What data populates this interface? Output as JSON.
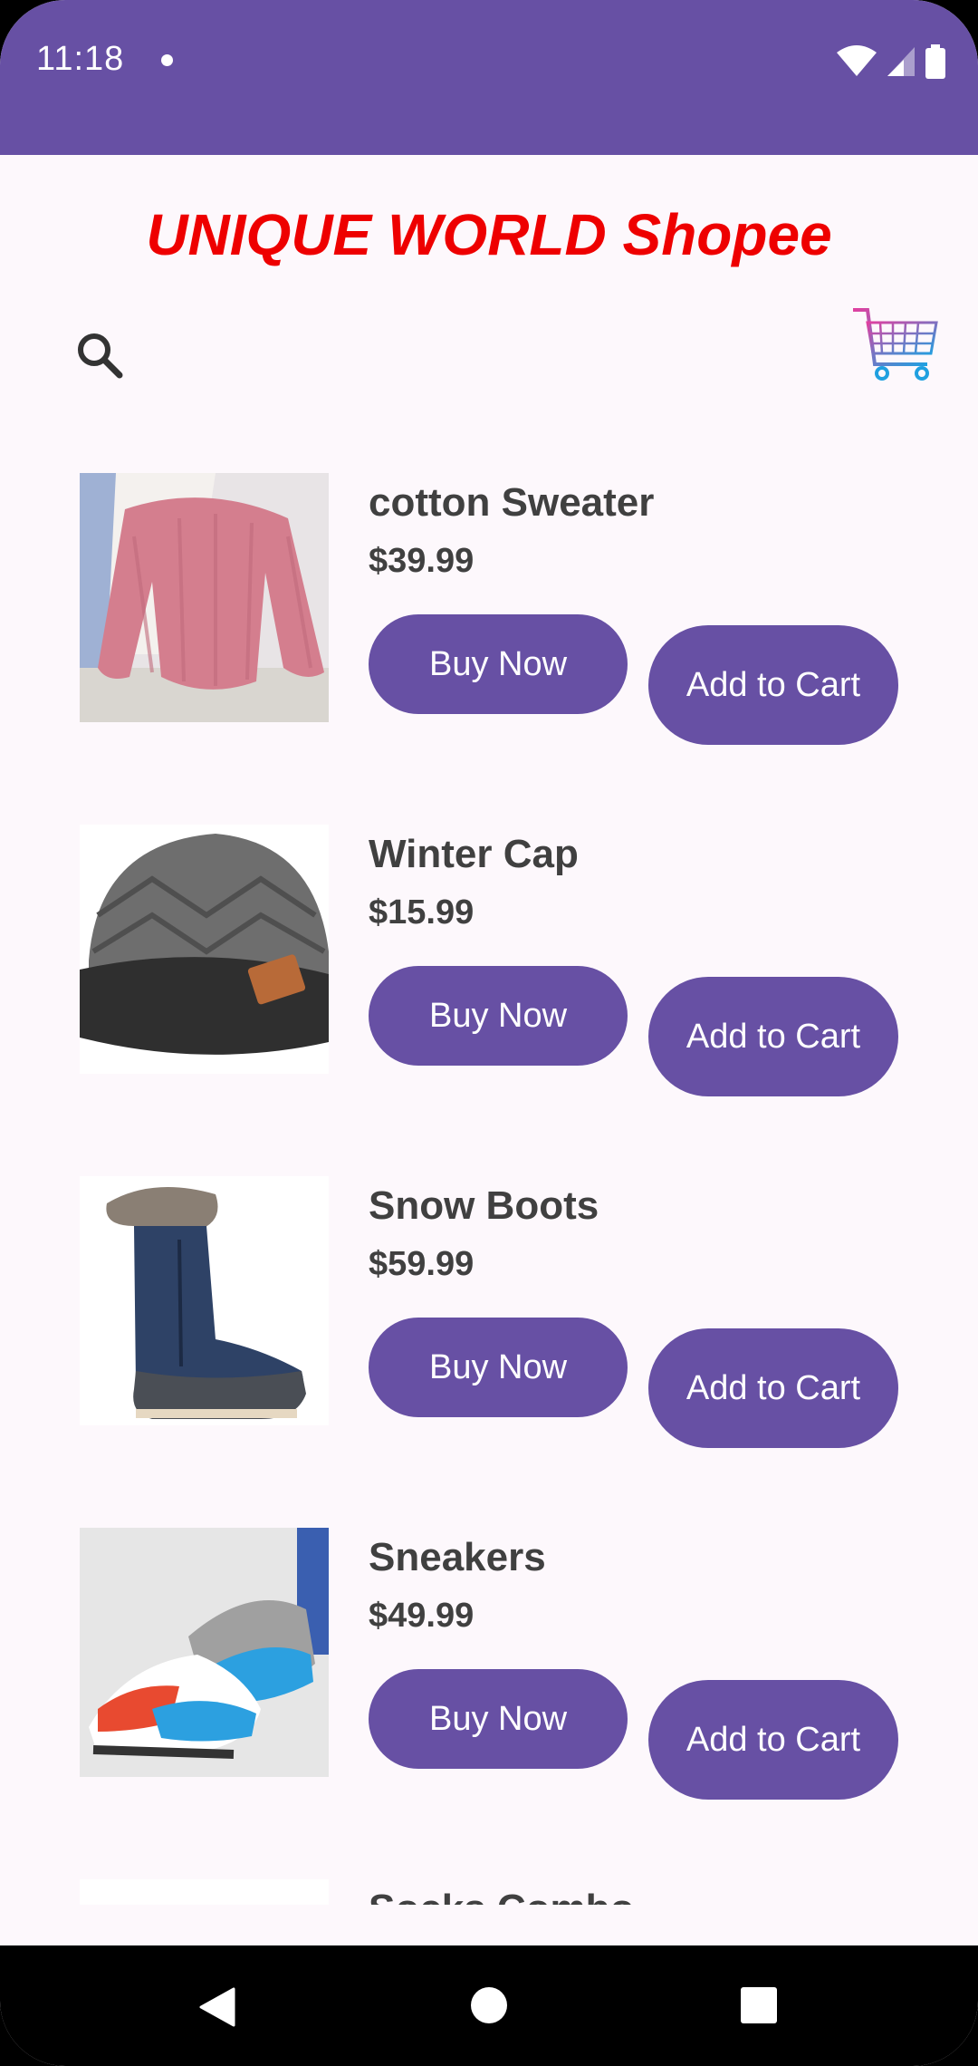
{
  "status_bar": {
    "time": "11:18"
  },
  "header": {
    "title": "UNIQUE WORLD Shopee",
    "search_icon": "search-icon",
    "cart_icon": "shopping-cart-icon"
  },
  "products": [
    {
      "name": "cotton Sweater",
      "price": "$39.99",
      "buy_label": "Buy Now",
      "add_label": "Add to Cart",
      "image": "pink-sweater-photo"
    },
    {
      "name": "Winter Cap",
      "price": "$15.99",
      "buy_label": "Buy Now",
      "add_label": "Add to Cart",
      "image": "grey-beanie-photo"
    },
    {
      "name": "Snow Boots",
      "price": "$59.99",
      "buy_label": "Buy Now",
      "add_label": "Add to Cart",
      "image": "navy-snow-boot-photo"
    },
    {
      "name": "Sneakers",
      "price": "$49.99",
      "buy_label": "Buy Now",
      "add_label": "Add to Cart",
      "image": "sneakers-photo"
    },
    {
      "name": "Socks Combo"
    }
  ],
  "colors": {
    "primary": "#6750a4",
    "title": "#ee0000",
    "background": "#fdf8fc",
    "text": "#404040"
  },
  "nav": {
    "back_icon": "back-icon",
    "home_icon": "home-icon",
    "recents_icon": "recents-icon"
  }
}
